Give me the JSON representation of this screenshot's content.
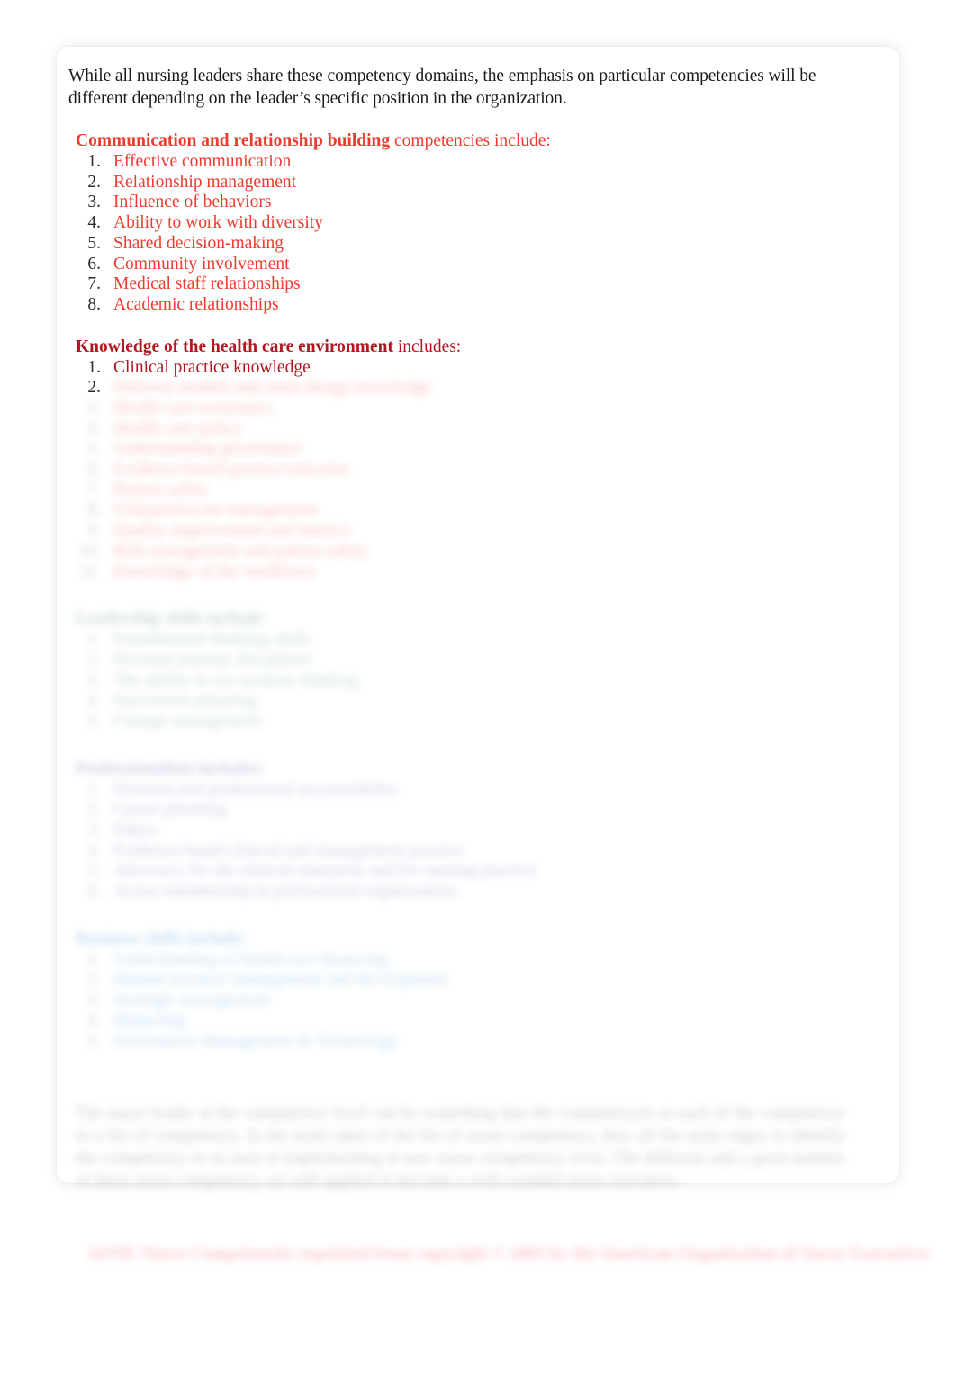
{
  "document": {
    "intro_paragraph": "While all nursing leaders share these competency domains, the emphasis on particular competencies will be different depending on the leader’s specific position in the organization."
  },
  "section_communication": {
    "heading_strong": "Communication and relationship building",
    "heading_rest": " competencies include:",
    "items": [
      {
        "num": "1.",
        "label": "Effective communication"
      },
      {
        "num": "2.",
        "label": "Relationship management"
      },
      {
        "num": "3.",
        "label": "Influence of behaviors"
      },
      {
        "num": "4.",
        "label": "Ability to work with diversity"
      },
      {
        "num": "5.",
        "label": "Shared decision-making"
      },
      {
        "num": "6.",
        "label": "Community involvement"
      },
      {
        "num": "7.",
        "label": "Medical staff relationships"
      },
      {
        "num": "8.",
        "label": "Academic relationships"
      }
    ]
  },
  "section_knowledge": {
    "heading_strong": "Knowledge of the health care environment",
    "heading_rest": " includes:",
    "items": [
      {
        "num": "1.",
        "label": "Clinical practice knowledge"
      }
    ],
    "redacted_items": [
      {
        "num": "2.",
        "label": "Delivery models and work design knowledge"
      },
      {
        "num": "3.",
        "label": "Health care economics"
      },
      {
        "num": "4.",
        "label": "Health care policy"
      },
      {
        "num": "5.",
        "label": "Understanding governance"
      },
      {
        "num": "6.",
        "label": "Evidence-based practice/outcome"
      },
      {
        "num": "7.",
        "label": "Patient safety"
      },
      {
        "num": "8.",
        "label": "Utilization/case management"
      },
      {
        "num": "9.",
        "label": "Quality improvement and metrics"
      },
      {
        "num": "10.",
        "label": "Risk management and patient safety"
      },
      {
        "num": "11.",
        "label": "Knowledge of the workforce"
      }
    ]
  },
  "section_green": {
    "heading": "Leadership skills include:",
    "redacted_items": [
      {
        "num": "1.",
        "label": "Foundational thinking skills"
      },
      {
        "num": "2.",
        "label": "Personal journey disciplines"
      },
      {
        "num": "3.",
        "label": "The ability to use systems thinking"
      },
      {
        "num": "4.",
        "label": "Succession planning"
      },
      {
        "num": "5.",
        "label": "Change management"
      }
    ]
  },
  "section_purple": {
    "heading": "Professionalism includes:",
    "redacted_items": [
      {
        "num": "1.",
        "label": "Personal and professional accountability"
      },
      {
        "num": "2.",
        "label": "Career planning"
      },
      {
        "num": "3.",
        "label": "Ethics"
      },
      {
        "num": "4.",
        "label": "Evidence-based clinical and management practice"
      },
      {
        "num": "5.",
        "label": "Advocacy for the clinical enterprise and for nursing practice"
      },
      {
        "num": "6.",
        "label": "Active membership in professional organizations"
      }
    ]
  },
  "section_blue": {
    "heading": "Business skills include:",
    "redacted_items": [
      {
        "num": "1.",
        "label": "Understanding of health care financing"
      },
      {
        "num": "2.",
        "label": "Human resource management and development"
      },
      {
        "num": "3.",
        "label": "Strategic management"
      },
      {
        "num": "4.",
        "label": "Marketing"
      },
      {
        "num": "5.",
        "label": "Information Management & Technology"
      }
    ]
  },
  "closing": {
    "redacted_paragraph": "The nurse leader at the competency level can be something that the competencies at each of the competency in a list of competency. In the main takes of the list of nurse competency, they all the main edges to identify the competency in an area of implementing at new nurse competency level. The different and a great number of these nurse competency are still applied to become a well-rounded nurse executive.",
    "redacted_footer": "AONE Nurse Competencies reprinted from copyright © 2005 by the American Organization of Nurse Executives"
  },
  "colors": {
    "heading_red": "#ed3b2e",
    "heading_crimson": "#b01721",
    "body_text": "#1a1a1a",
    "redacted_green": "#4f8a77",
    "redacted_purple": "#6d5aa8",
    "redacted_blue": "#3b93d8",
    "page_background": "#ffffff"
  }
}
